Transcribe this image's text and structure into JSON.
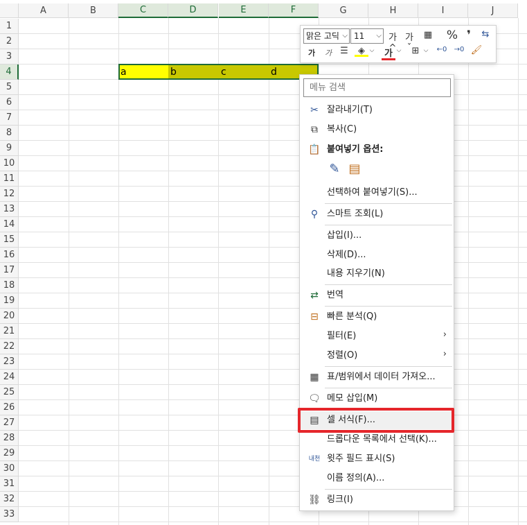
{
  "columns": [
    "A",
    "B",
    "C",
    "D",
    "E",
    "F",
    "G",
    "H",
    "I",
    "J"
  ],
  "rows": [
    "1",
    "2",
    "3",
    "4",
    "5",
    "6",
    "7",
    "8",
    "9",
    "10",
    "11",
    "12",
    "13",
    "14",
    "15",
    "16",
    "17",
    "18",
    "19",
    "20",
    "21",
    "22",
    "23",
    "24",
    "25",
    "26",
    "27",
    "28",
    "29",
    "30",
    "31",
    "32",
    "33"
  ],
  "cells": {
    "C4": "a",
    "D4": "b",
    "E4": "c",
    "F4": "d"
  },
  "colors": {
    "yellow": "#ffff00",
    "olive": "#c8c800",
    "highlight_red": "#e5262b",
    "selection_green": "#1e6b37"
  },
  "mini_toolbar": {
    "font_name": "맑은 고딕",
    "font_size": "11",
    "grow_font": "가^",
    "shrink_font": "가ˇ",
    "percent": "%",
    "comma": "❜",
    "bold": "가",
    "italic": "가",
    "font_color_label": "가"
  },
  "context_menu": {
    "search_placeholder": "메뉴 검색",
    "cut": "잘라내기(T)",
    "copy": "복사(C)",
    "paste_options": "붙여넣기 옵션:",
    "paste_special": "선택하여 붙여넣기(S)...",
    "smart_lookup": "스마트 조회(L)",
    "insert": "삽입(I)...",
    "delete": "삭제(D)...",
    "clear_contents": "내용 지우기(N)",
    "translate": "번역",
    "quick_analysis": "빠른 분석(Q)",
    "filter": "필터(E)",
    "sort": "정렬(O)",
    "get_data": "표/범위에서 데이터 가져오...",
    "insert_comment": "메모 삽입(M)",
    "format_cells": "셀 서식(F)...",
    "pick_from_list": "드롭다운 목록에서 선택(K)...",
    "phonetic": "윗주 필드 표시(S)",
    "define_name": "이름 정의(A)...",
    "link": "링크(I)"
  }
}
